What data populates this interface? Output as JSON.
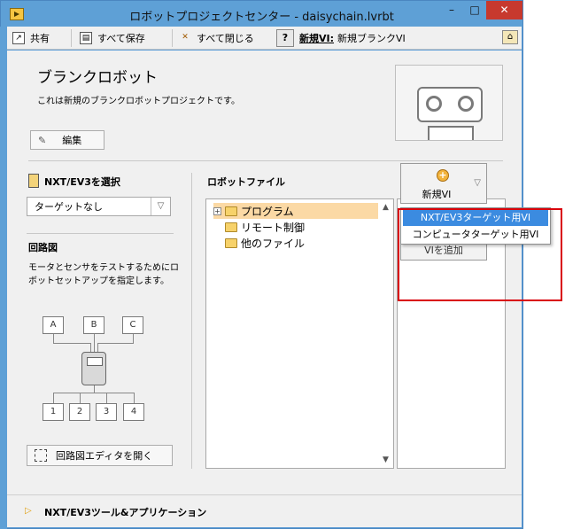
{
  "window": {
    "title": "ロボットプロジェクトセンター - daisychain.lvrbt",
    "minimize": "–",
    "maximize": "□",
    "close": "✕"
  },
  "toolbar": {
    "share": "共有",
    "save_all": "すべて保存",
    "close_all": "すべて閉じる",
    "new_vi_prefix": "新規VI:",
    "new_vi_name": "新規ブランクVI"
  },
  "project": {
    "title": "ブランクロボット",
    "description": "これは新規のブランクロボットプロジェクトです。",
    "edit_label": "編集"
  },
  "target": {
    "section_label": "NXT/EV3を選択",
    "selected": "ターゲットなし"
  },
  "circuit": {
    "section_label": "回路図",
    "description": "モータとセンサをテストするためにロボットセットアップを指定します。",
    "ports_top": [
      "A",
      "B",
      "C"
    ],
    "ports_bottom": [
      "1",
      "2",
      "3",
      "4"
    ],
    "open_editor": "回路図エディタを開く"
  },
  "files": {
    "section_label": "ロボットファイル",
    "tree": [
      {
        "label": "プログラム",
        "expandable": true,
        "selected": true
      },
      {
        "label": "リモート制御",
        "expandable": false,
        "selected": false
      },
      {
        "label": "他のファイル",
        "expandable": false,
        "selected": false
      }
    ]
  },
  "actions": {
    "new_vi": "新規VI",
    "add_vi": "VIを追加",
    "menu": [
      {
        "label": "NXT/EV3ターゲット用VI",
        "highlighted": true
      },
      {
        "label": "コンピュータターゲット用VI",
        "highlighted": false
      }
    ]
  },
  "bottom": {
    "tools_label": "NXT/EV3ツール&アプリケーション"
  },
  "colors": {
    "titlebar": "#5ea0d6",
    "close_button": "#c7392e",
    "highlight": "#3b8be0",
    "selection": "#fbd9a5",
    "annotation": "#d9000a"
  }
}
